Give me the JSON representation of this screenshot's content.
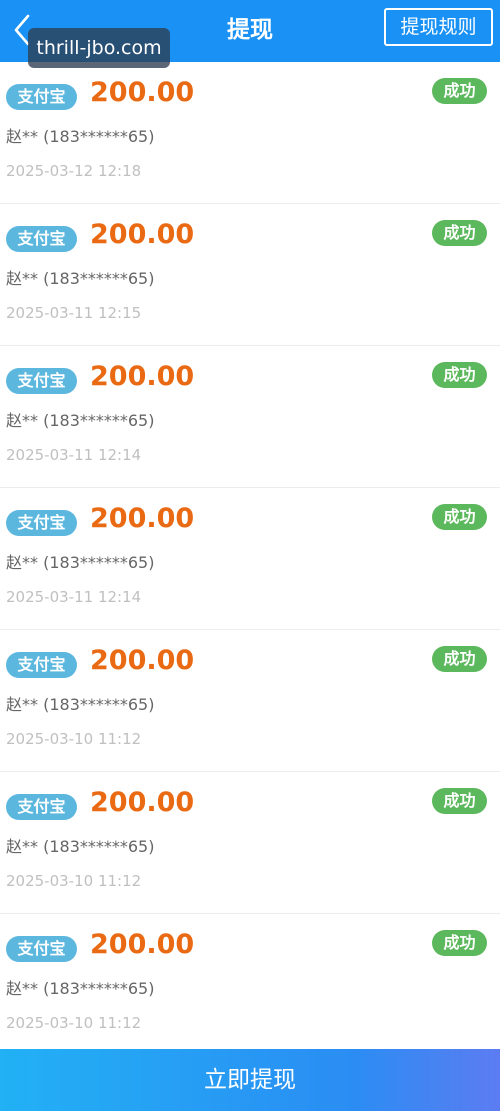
{
  "header": {
    "title": "提现",
    "rules_label": "提现规则",
    "back_icon": "chevron-left-icon"
  },
  "watermark": {
    "text": "thrill-jbo.com"
  },
  "records": [
    {
      "method": "支付宝",
      "amount": "200.00",
      "status": "成功",
      "account": "赵** (183******65)",
      "time": "2025-03-12 12:18"
    },
    {
      "method": "支付宝",
      "amount": "200.00",
      "status": "成功",
      "account": "赵** (183******65)",
      "time": "2025-03-11 12:15"
    },
    {
      "method": "支付宝",
      "amount": "200.00",
      "status": "成功",
      "account": "赵** (183******65)",
      "time": "2025-03-11 12:14"
    },
    {
      "method": "支付宝",
      "amount": "200.00",
      "status": "成功",
      "account": "赵** (183******65)",
      "time": "2025-03-11 12:14"
    },
    {
      "method": "支付宝",
      "amount": "200.00",
      "status": "成功",
      "account": "赵** (183******65)",
      "time": "2025-03-10 11:12"
    },
    {
      "method": "支付宝",
      "amount": "200.00",
      "status": "成功",
      "account": "赵** (183******65)",
      "time": "2025-03-10 11:12"
    },
    {
      "method": "支付宝",
      "amount": "200.00",
      "status": "成功",
      "account": "赵** (183******65)",
      "time": "2025-03-10 11:12"
    }
  ],
  "footer": {
    "withdraw_label": "立即提现"
  },
  "colors": {
    "header_bg": "#1a92f5",
    "amount": "#ea6a14",
    "method_badge": "#5bb7de",
    "status_success": "#5cb85c",
    "account_text": "#666666",
    "time_text": "#c0c0c0"
  }
}
